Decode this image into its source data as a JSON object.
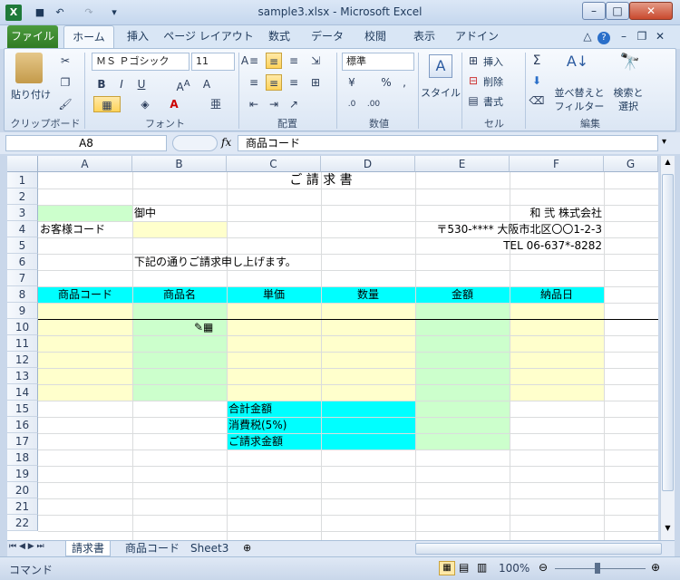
{
  "window": {
    "title": "sample3.xlsx  -  Microsoft Excel",
    "min_label": "–",
    "max_label": "□",
    "close_label": "✕"
  },
  "quick_access": {
    "save": "💾",
    "undo": "↶",
    "redo": "↷"
  },
  "tabs": [
    "ファイル",
    "ホーム",
    "挿入",
    "ページ レイアウト",
    "数式",
    "データ",
    "校閲",
    "表示",
    "アドイン"
  ],
  "ribbon": {
    "clipboard": {
      "paste": "貼り付け",
      "label": "クリップボード"
    },
    "font": {
      "name": "ＭＳ Ｐゴシック",
      "size": "11",
      "label": "フォント"
    },
    "align": {
      "label": "配置"
    },
    "number": {
      "format": "標準",
      "label": "数値"
    },
    "styles": {
      "style": "スタイル"
    },
    "cells": {
      "insert": "挿入",
      "delete": "削除",
      "format": "書式",
      "label": "セル"
    },
    "edit": {
      "sort": "並べ替えと",
      "filter": "フィルター",
      "find": "検索と",
      "select": "選択",
      "label": "編集"
    }
  },
  "formula_bar": {
    "name_box": "A8",
    "fx": "fx",
    "content": "商品コード"
  },
  "columns": [
    "A",
    "B",
    "C",
    "D",
    "E",
    "F",
    "G"
  ],
  "rows": [
    "1",
    "2",
    "3",
    "4",
    "5",
    "6",
    "7",
    "8",
    "9",
    "10",
    "11",
    "12",
    "13",
    "14",
    "15",
    "16",
    "17",
    "18",
    "19",
    "20",
    "21",
    "22"
  ],
  "cells": {
    "title": "ご 請 求 書",
    "b3": "御中",
    "a4": "お客様コード",
    "company": "和 弐 株式会社",
    "address": "〒530-****  大阪市北区〇〇1-2-3",
    "tel": "TEL  06-637*-8282",
    "b6": "下記の通りご請求申し上げます。",
    "headers": [
      "商品コード",
      "商品名",
      "単価",
      "数量",
      "金額",
      "納品日"
    ],
    "c15": "合計金額",
    "c16": "消費税(5%)",
    "c17": "ご請求金額"
  },
  "sheets": [
    "請求書",
    "商品コード",
    "Sheet3"
  ],
  "status": {
    "mode": "コマンド",
    "zoom": "100%"
  },
  "colors": {
    "green": "#ccffcc",
    "yellow": "#ffffcc",
    "cyan": "#00ffff"
  }
}
